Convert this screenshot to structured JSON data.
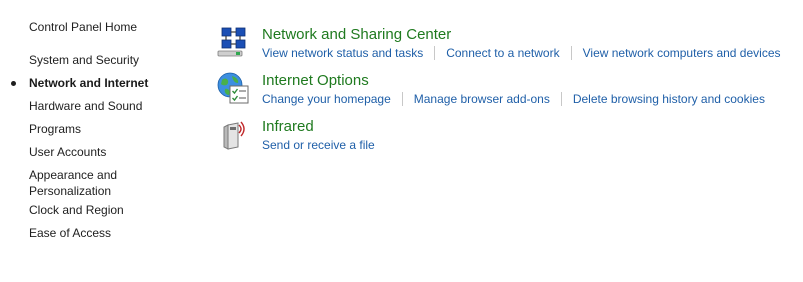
{
  "sidebar": {
    "home": "Control Panel Home",
    "items": [
      {
        "label": "System and Security"
      },
      {
        "label": "Network and Internet",
        "active": true
      },
      {
        "label": "Hardware and Sound"
      },
      {
        "label": "Programs"
      },
      {
        "label": "User Accounts"
      },
      {
        "label": "Appearance and\nPersonalization"
      },
      {
        "label": "Clock and Region"
      },
      {
        "label": "Ease of Access"
      }
    ]
  },
  "categories": [
    {
      "title": "Network and Sharing Center",
      "icon": "network-sharing-icon",
      "links": [
        "View network status and tasks",
        "Connect to a network",
        "View network computers and devices"
      ]
    },
    {
      "title": "Internet Options",
      "icon": "internet-options-icon",
      "links": [
        "Change your homepage",
        "Manage browser add-ons",
        "Delete browsing history and cookies"
      ]
    },
    {
      "title": "Infrared",
      "icon": "infrared-icon",
      "links": [
        "Send or receive a file"
      ]
    }
  ],
  "colors": {
    "category_title": "#1f7a1f",
    "link": "#1f5fa8",
    "sidebar_text": "#1e1e1e",
    "separator": "#c8c8c8"
  }
}
